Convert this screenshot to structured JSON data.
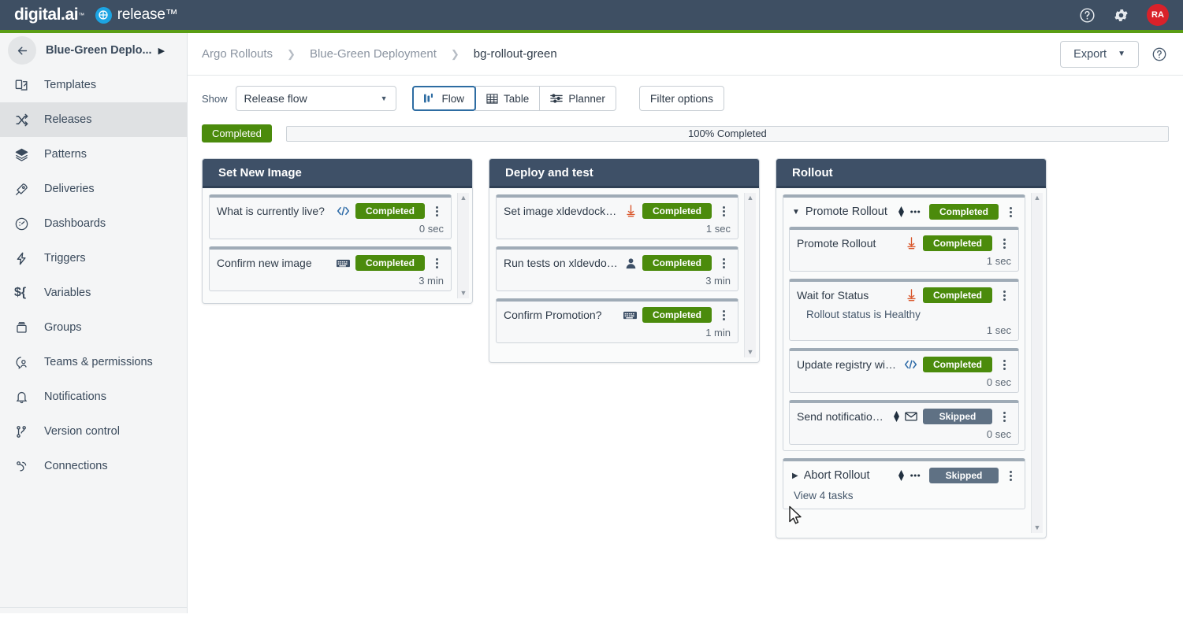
{
  "topbar": {
    "brand": "digital.ai",
    "product": "release",
    "product_icon": "globe-icon",
    "help_icon": "help-circle-icon",
    "settings_icon": "gear-icon",
    "avatar_initials": "RA",
    "avatar_color": "#d9212a",
    "bg_color": "#3e4f63",
    "accent_color": "#5a9d14"
  },
  "sidebar": {
    "title": "Blue-Green Deplo...",
    "back_icon": "arrow-left-icon",
    "expand_icon": "caret-right-icon",
    "items": [
      {
        "label": "Templates",
        "icon": "templates-icon",
        "active": false
      },
      {
        "label": "Releases",
        "icon": "shuffle-icon",
        "active": true
      },
      {
        "label": "Patterns",
        "icon": "layers-icon",
        "active": false
      },
      {
        "label": "Deliveries",
        "icon": "rocket-icon",
        "active": false
      },
      {
        "label": "Dashboards",
        "icon": "gauge-icon",
        "active": false
      },
      {
        "label": "Triggers",
        "icon": "bolt-icon",
        "active": false
      },
      {
        "label": "Variables",
        "icon": "dollar-brace-icon",
        "active": false
      },
      {
        "label": "Groups",
        "icon": "box-icon",
        "active": false
      },
      {
        "label": "Teams & permissions",
        "icon": "user-shield-icon",
        "active": false
      },
      {
        "label": "Notifications",
        "icon": "bell-icon",
        "active": false
      },
      {
        "label": "Version control",
        "icon": "git-branch-icon",
        "active": false
      },
      {
        "label": "Connections",
        "icon": "plug-icon",
        "active": false
      }
    ]
  },
  "breadcrumb": {
    "items": [
      "Argo Rollouts",
      "Blue-Green Deployment",
      "bg-rollout-green"
    ],
    "separator": "›",
    "export_label": "Export",
    "export_caret_icon": "caret-down-icon",
    "help_icon": "help-circle-icon"
  },
  "toolbar": {
    "show_label": "Show",
    "select_value": "Release flow",
    "select_caret_icon": "caret-down-icon",
    "views": [
      {
        "label": "Flow",
        "icon": "flow-icon",
        "active": true
      },
      {
        "label": "Table",
        "icon": "table-icon",
        "active": false
      },
      {
        "label": "Planner",
        "icon": "planner-icon",
        "active": false
      }
    ],
    "filter_label": "Filter options"
  },
  "status": {
    "badge": "Completed",
    "badge_color": "#4b8b0c",
    "progress_text": "100% Completed",
    "progress_percent": 100
  },
  "phases": [
    {
      "title": "Set New Image",
      "scrollable": true,
      "tasks": [
        {
          "type": "task",
          "title": "What is currently live?",
          "icons": [
            "code-icon"
          ],
          "status": "Completed",
          "status_kind": "completed",
          "time": "0 sec",
          "kebab_icon": "kebab-menu-icon"
        },
        {
          "type": "task",
          "title": "Confirm new image",
          "icons": [
            "keyboard-icon"
          ],
          "status": "Completed",
          "status_kind": "completed",
          "time": "3 min",
          "kebab_icon": "kebab-menu-icon"
        }
      ]
    },
    {
      "title": "Deploy and test",
      "scrollable": true,
      "tasks": [
        {
          "type": "task",
          "title": "Set image xldevdocker/gue...",
          "icons": [
            "kubernetes-icon"
          ],
          "status": "Completed",
          "status_kind": "completed",
          "time": "1 sec",
          "kebab_icon": "kebab-menu-icon"
        },
        {
          "type": "task",
          "title": "Run tests on xldevdocker/g...",
          "icons": [
            "user-icon"
          ],
          "status": "Completed",
          "status_kind": "completed",
          "time": "3 min",
          "kebab_icon": "kebab-menu-icon"
        },
        {
          "type": "task",
          "title": "Confirm Promotion?",
          "icons": [
            "keyboard-icon"
          ],
          "status": "Completed",
          "status_kind": "completed",
          "time": "1 min",
          "kebab_icon": "kebab-menu-icon"
        }
      ]
    },
    {
      "title": "Rollout",
      "scrollable": true,
      "tasks": [
        {
          "type": "group",
          "title": "Promote Rollout",
          "expanded": true,
          "caret_icon": "caret-down-icon",
          "icons": [
            "diamond-icon",
            "dots-icon"
          ],
          "status": "Completed",
          "status_kind": "completed",
          "kebab_icon": "kebab-menu-icon",
          "children": [
            {
              "type": "task",
              "title": "Promote Rollout",
              "icons": [
                "kubernetes-icon"
              ],
              "status": "Completed",
              "status_kind": "completed",
              "time": "1 sec",
              "kebab_icon": "kebab-menu-icon"
            },
            {
              "type": "task",
              "title": "Wait for Status",
              "icons": [
                "kubernetes-icon"
              ],
              "status": "Completed",
              "status_kind": "completed",
              "time": "1 sec",
              "subtitle": "Rollout status is Healthy",
              "kebab_icon": "kebab-menu-icon"
            },
            {
              "type": "task",
              "title": "Update registry with liv...",
              "icons": [
                "code-icon"
              ],
              "status": "Completed",
              "status_kind": "completed",
              "time": "0 sec",
              "kebab_icon": "kebab-menu-icon"
            },
            {
              "type": "task",
              "title": "Send notification tha...",
              "icons": [
                "diamond-icon",
                "mail-icon"
              ],
              "status": "Skipped",
              "status_kind": "skipped",
              "time": "0 sec",
              "kebab_icon": "kebab-menu-icon"
            }
          ]
        },
        {
          "type": "group",
          "title": "Abort Rollout",
          "expanded": false,
          "caret_icon": "caret-right-icon",
          "icons": [
            "diamond-icon",
            "dots-icon"
          ],
          "status": "Skipped",
          "status_kind": "skipped",
          "kebab_icon": "kebab-menu-icon",
          "collapsed_label": "View 4 tasks",
          "children": []
        }
      ]
    }
  ]
}
